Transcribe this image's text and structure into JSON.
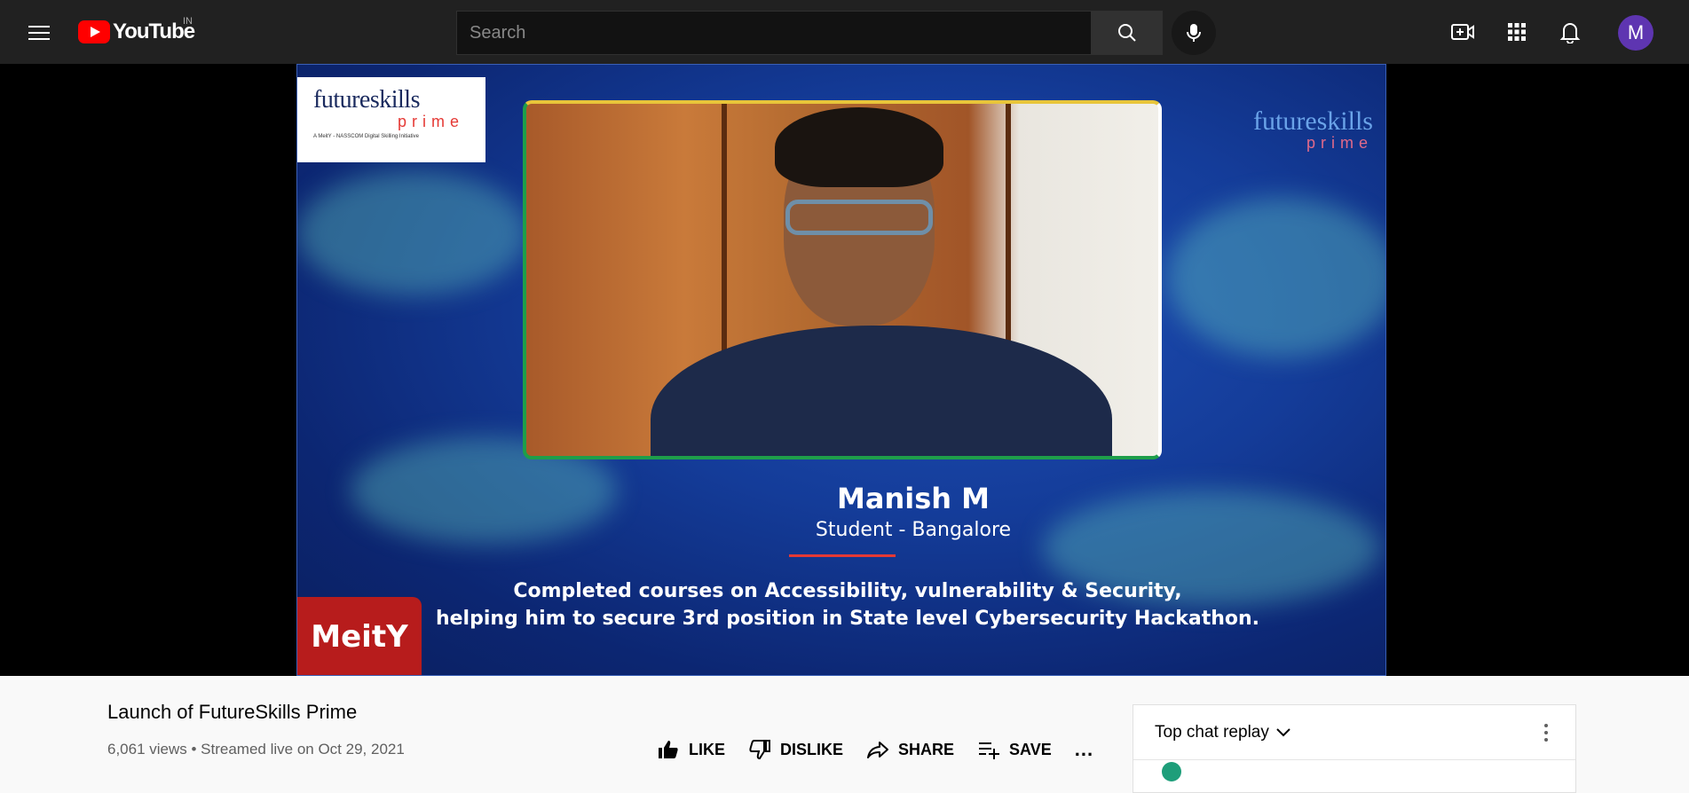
{
  "header": {
    "logo_text": "YouTube",
    "country_code": "IN",
    "search_placeholder": "Search",
    "avatar_letter": "M"
  },
  "video": {
    "logo_word": "futureskills",
    "logo_prime": "prime",
    "logo_tagline": "A MeitY - NASSCOM Digital Skilling Initiative",
    "speaker_name": "Manish M",
    "speaker_role": "Student - Bangalore",
    "caption_line1": "Completed courses on Accessibility, vulnerability & Security,",
    "caption_line2": "helping him to secure 3rd position in State level Cybersecurity Hackathon.",
    "corner_badge": "MeitY"
  },
  "info": {
    "title": "Launch of FutureSkills Prime",
    "meta": "6,061 views • Streamed live on Oct 29, 2021"
  },
  "actions": {
    "like": "LIKE",
    "dislike": "DISLIKE",
    "share": "SHARE",
    "save": "SAVE",
    "more": "..."
  },
  "chat": {
    "title": "Top chat replay"
  },
  "colors": {
    "brand_red": "#ff0000",
    "topbar_bg": "#212121",
    "avatar_bg": "#5e35b1"
  },
  "icons": [
    "menu-icon",
    "youtube-logo-icon",
    "search-icon",
    "mic-icon",
    "create-video-icon",
    "apps-grid-icon",
    "bell-icon",
    "thumbs-up-icon",
    "thumbs-down-icon",
    "share-icon",
    "save-playlist-icon",
    "chevron-down-icon",
    "kebab-menu-icon"
  ]
}
